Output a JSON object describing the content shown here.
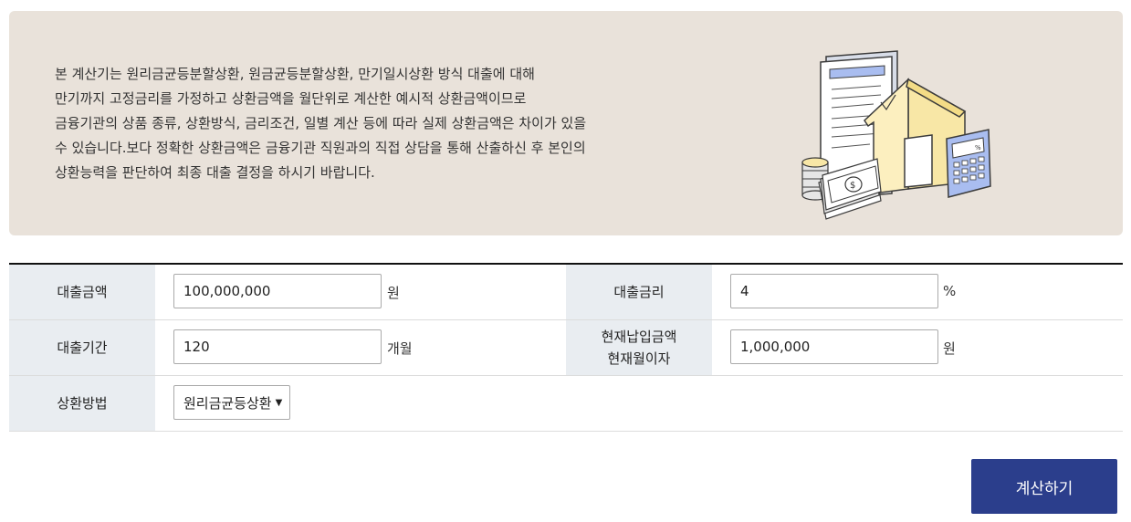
{
  "notice": {
    "lines": [
      "본 계산기는 원리금균등분할상환, 원금균등분할상환, 만기일시상환 방식 대출에 대해",
      "만기까지 고정금리를 가정하고 상환금액을 월단위로 계산한 예시적 상환금액이므로",
      "금융기관의 상품 종류, 상환방식, 금리조건, 일별 계산 등에 따라 실제 상환금액은 차이가 있을",
      "수 있습니다.보다 정확한 상환금액은 금융기관 직원과의 직접 상담을 통해 산출하신 후 본인의",
      "상환능력을 판단하여 최종 대출 결정을 하시기 바랍니다."
    ],
    "illustration_icons": [
      "document-icon",
      "house-icon",
      "calculator-icon",
      "coins-icon",
      "money-stack-icon"
    ]
  },
  "form": {
    "loan_amount": {
      "label": "대출금액",
      "value": "100,000,000",
      "unit": "원"
    },
    "interest_rate": {
      "label": "대출금리",
      "value": "4",
      "unit": "%"
    },
    "loan_period": {
      "label": "대출기간",
      "value": "120",
      "unit": "개월"
    },
    "current_payment": {
      "label_line1": "현재납입금액",
      "label_line2": "현재월이자",
      "value": "1,000,000",
      "unit": "원"
    },
    "repayment_method": {
      "label": "상환방법",
      "selected": "원리금균등상환"
    }
  },
  "actions": {
    "calculate_label": "계산하기"
  },
  "colors": {
    "notice_bg": "#e9e2da",
    "label_bg": "#e9edf1",
    "button_bg": "#2b3e8c",
    "house_yellow": "#f8e7a6",
    "calc_blue": "#a9bdf0"
  }
}
